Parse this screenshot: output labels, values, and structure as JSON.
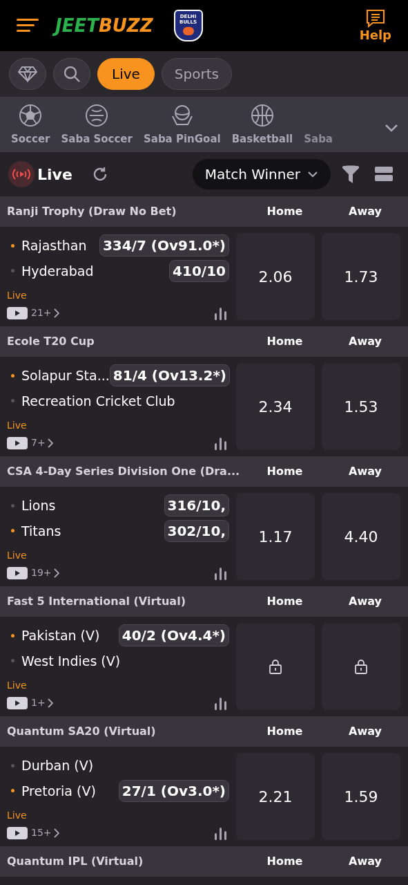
{
  "header": {
    "logo": [
      "JEET",
      "BUZZ"
    ],
    "badge": [
      "DELHI",
      "BULLS"
    ],
    "help": "Help"
  },
  "tabs": [
    {
      "kind": "diamond",
      "selected": false
    },
    {
      "kind": "search",
      "selected": false
    },
    {
      "label": "Live",
      "selected": true
    },
    {
      "label": "Sports",
      "selected": false
    }
  ],
  "sports": [
    {
      "label": "Soccer",
      "kind": "soccer"
    },
    {
      "label": "Saba Soccer",
      "kind": "saba"
    },
    {
      "label": "Saba PinGoal",
      "kind": "pingoal"
    },
    {
      "label": "Basketball",
      "kind": "basketball"
    },
    {
      "label": "Saba",
      "kind": "partial",
      "faded": true
    }
  ],
  "toolbar": {
    "title": "Live",
    "market": "Match Winner"
  },
  "leagues": [
    {
      "name": "Ranji Trophy (Draw No Bet)",
      "col1": "Home",
      "col2": "Away",
      "teams": [
        {
          "name": "Rajasthan",
          "batting": true,
          "score": "334/7 (Ov91.0*)"
        },
        {
          "name": "Hyderabad",
          "batting": false,
          "score": "410/10"
        }
      ],
      "status": "Live",
      "count": "21+",
      "odds": [
        {
          "kind": "price",
          "value": "2.06"
        },
        {
          "kind": "price",
          "value": "1.73"
        }
      ]
    },
    {
      "name": "Ecole T20 Cup",
      "col1": "Home",
      "col2": "Away",
      "teams": [
        {
          "name": "Solapur Sta...",
          "batting": true,
          "score": "81/4 (Ov13.2*)"
        },
        {
          "name": "Recreation Cricket Club",
          "batting": false
        }
      ],
      "status": "Live",
      "count": "7+",
      "odds": [
        {
          "kind": "price",
          "value": "2.34"
        },
        {
          "kind": "price",
          "value": "1.53"
        }
      ]
    },
    {
      "name": "CSA 4-Day Series Division One (Dra...",
      "col1": "Home",
      "col2": "Away",
      "teams": [
        {
          "name": "Lions",
          "batting": false,
          "score": "316/10,"
        },
        {
          "name": "Titans",
          "batting": true,
          "score": "302/10,"
        }
      ],
      "status": "Live",
      "count": "19+",
      "odds": [
        {
          "kind": "price",
          "value": "1.17"
        },
        {
          "kind": "price",
          "value": "4.40"
        }
      ]
    },
    {
      "name": "Fast 5 International (Virtual)",
      "col1": "Home",
      "col2": "Away",
      "teams": [
        {
          "name": "Pakistan (V)",
          "batting": true,
          "score": "40/2 (Ov4.4*)"
        },
        {
          "name": "West Indies (V)",
          "batting": false
        }
      ],
      "status": "Live",
      "count": "1+",
      "odds": [
        {
          "kind": "locked"
        },
        {
          "kind": "locked"
        }
      ]
    },
    {
      "name": "Quantum SA20 (Virtual)",
      "col1": "Home",
      "col2": "Away",
      "teams": [
        {
          "name": "Durban (V)",
          "batting": false
        },
        {
          "name": "Pretoria (V)",
          "batting": true,
          "score": "27/1 (Ov3.0*)"
        }
      ],
      "status": "Live",
      "count": "15+",
      "odds": [
        {
          "kind": "price",
          "value": "2.21"
        },
        {
          "kind": "price",
          "value": "1.59"
        }
      ]
    },
    {
      "name": "Quantum IPL (Virtual)",
      "col1": "Home",
      "col2": "Away"
    }
  ]
}
